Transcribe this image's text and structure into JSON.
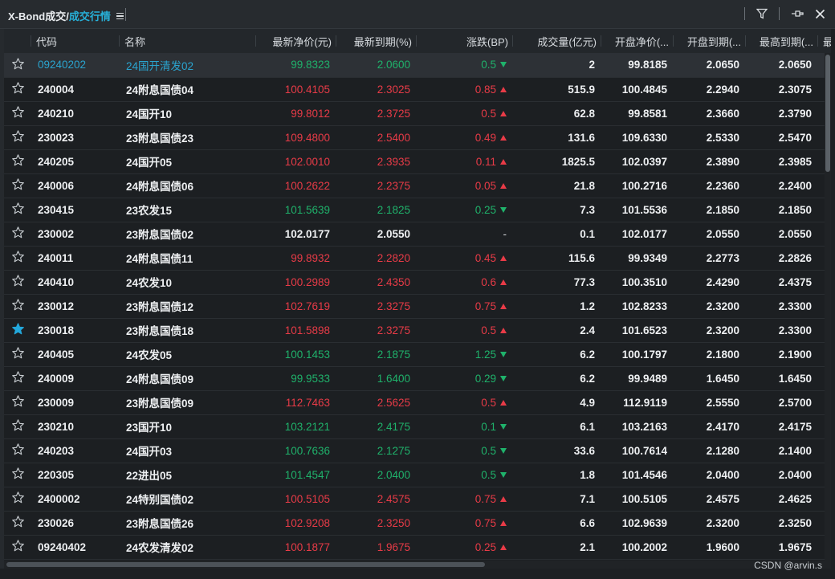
{
  "window": {
    "title_main": "X-Bond成交/",
    "title_sub": "成交行情",
    "watermark": "CSDN @arvin.s"
  },
  "icons": {
    "menu": "menu-icon",
    "filter": "filter-icon",
    "pin": "pin-icon",
    "close": "close-icon",
    "star": "star-icon"
  },
  "colors": {
    "up": "#e83b47",
    "down": "#1fb26b",
    "link": "#2aa4cf",
    "favorite": "#23a8dc"
  },
  "columns": [
    "代码",
    "名称",
    "最新净价(元)",
    "最新到期(%)",
    "涨跌(BP)",
    "成交量(亿元)",
    "开盘净价(...",
    "开盘到期(...",
    "最高到期(...",
    "最"
  ],
  "rows": [
    {
      "code": "09240202",
      "name": "24国开清发02",
      "price": "99.8323",
      "ytm": "2.0600",
      "change": "0.5",
      "dir": "down",
      "volume": "2",
      "open_price": "99.8185",
      "open_ytm": "2.0650",
      "high_ytm": "2.0650",
      "favorite": false
    },
    {
      "code": "240004",
      "name": "24附息国债04",
      "price": "100.4105",
      "ytm": "2.3025",
      "change": "0.85",
      "dir": "up",
      "volume": "515.9",
      "open_price": "100.4845",
      "open_ytm": "2.2940",
      "high_ytm": "2.3075",
      "favorite": false
    },
    {
      "code": "240210",
      "name": "24国开10",
      "price": "99.8012",
      "ytm": "2.3725",
      "change": "0.5",
      "dir": "up",
      "volume": "62.8",
      "open_price": "99.8581",
      "open_ytm": "2.3660",
      "high_ytm": "2.3790",
      "favorite": false
    },
    {
      "code": "230023",
      "name": "23附息国债23",
      "price": "109.4800",
      "ytm": "2.5400",
      "change": "0.49",
      "dir": "up",
      "volume": "131.6",
      "open_price": "109.6330",
      "open_ytm": "2.5330",
      "high_ytm": "2.5470",
      "favorite": false
    },
    {
      "code": "240205",
      "name": "24国开05",
      "price": "102.0010",
      "ytm": "2.3935",
      "change": "0.11",
      "dir": "up",
      "volume": "1825.5",
      "open_price": "102.0397",
      "open_ytm": "2.3890",
      "high_ytm": "2.3985",
      "favorite": false
    },
    {
      "code": "240006",
      "name": "24附息国债06",
      "price": "100.2622",
      "ytm": "2.2375",
      "change": "0.05",
      "dir": "up",
      "volume": "21.8",
      "open_price": "100.2716",
      "open_ytm": "2.2360",
      "high_ytm": "2.2400",
      "favorite": false
    },
    {
      "code": "230415",
      "name": "23农发15",
      "price": "101.5639",
      "ytm": "2.1825",
      "change": "0.25",
      "dir": "down",
      "volume": "7.3",
      "open_price": "101.5536",
      "open_ytm": "2.1850",
      "high_ytm": "2.1850",
      "favorite": false
    },
    {
      "code": "230002",
      "name": "23附息国债02",
      "price": "102.0177",
      "ytm": "2.0550",
      "change": "-",
      "dir": "flat",
      "volume": "0.1",
      "open_price": "102.0177",
      "open_ytm": "2.0550",
      "high_ytm": "2.0550",
      "favorite": false
    },
    {
      "code": "240011",
      "name": "24附息国债11",
      "price": "99.8932",
      "ytm": "2.2820",
      "change": "0.45",
      "dir": "up",
      "volume": "115.6",
      "open_price": "99.9349",
      "open_ytm": "2.2773",
      "high_ytm": "2.2826",
      "favorite": false
    },
    {
      "code": "240410",
      "name": "24农发10",
      "price": "100.2989",
      "ytm": "2.4350",
      "change": "0.6",
      "dir": "up",
      "volume": "77.3",
      "open_price": "100.3510",
      "open_ytm": "2.4290",
      "high_ytm": "2.4375",
      "favorite": false
    },
    {
      "code": "230012",
      "name": "23附息国债12",
      "price": "102.7619",
      "ytm": "2.3275",
      "change": "0.75",
      "dir": "up",
      "volume": "1.2",
      "open_price": "102.8233",
      "open_ytm": "2.3200",
      "high_ytm": "2.3300",
      "favorite": false
    },
    {
      "code": "230018",
      "name": "23附息国债18",
      "price": "101.5898",
      "ytm": "2.3275",
      "change": "0.5",
      "dir": "up",
      "volume": "2.4",
      "open_price": "101.6523",
      "open_ytm": "2.3200",
      "high_ytm": "2.3300",
      "favorite": true
    },
    {
      "code": "240405",
      "name": "24农发05",
      "price": "100.1453",
      "ytm": "2.1875",
      "change": "1.25",
      "dir": "down",
      "volume": "6.2",
      "open_price": "100.1797",
      "open_ytm": "2.1800",
      "high_ytm": "2.1900",
      "favorite": false
    },
    {
      "code": "240009",
      "name": "24附息国债09",
      "price": "99.9533",
      "ytm": "1.6400",
      "change": "0.29",
      "dir": "down",
      "volume": "6.2",
      "open_price": "99.9489",
      "open_ytm": "1.6450",
      "high_ytm": "1.6450",
      "favorite": false
    },
    {
      "code": "230009",
      "name": "23附息国债09",
      "price": "112.7463",
      "ytm": "2.5625",
      "change": "0.5",
      "dir": "up",
      "volume": "4.9",
      "open_price": "112.9119",
      "open_ytm": "2.5550",
      "high_ytm": "2.5700",
      "favorite": false
    },
    {
      "code": "230210",
      "name": "23国开10",
      "price": "103.2121",
      "ytm": "2.4175",
      "change": "0.1",
      "dir": "down",
      "volume": "6.1",
      "open_price": "103.2163",
      "open_ytm": "2.4170",
      "high_ytm": "2.4175",
      "favorite": false
    },
    {
      "code": "240203",
      "name": "24国开03",
      "price": "100.7636",
      "ytm": "2.1275",
      "change": "0.5",
      "dir": "down",
      "volume": "33.6",
      "open_price": "100.7614",
      "open_ytm": "2.1280",
      "high_ytm": "2.1400",
      "favorite": false
    },
    {
      "code": "220305",
      "name": "22进出05",
      "price": "101.4547",
      "ytm": "2.0400",
      "change": "0.5",
      "dir": "down",
      "volume": "1.8",
      "open_price": "101.4546",
      "open_ytm": "2.0400",
      "high_ytm": "2.0400",
      "favorite": false
    },
    {
      "code": "2400002",
      "name": "24特别国债02",
      "price": "100.5105",
      "ytm": "2.4575",
      "change": "0.75",
      "dir": "up",
      "volume": "7.1",
      "open_price": "100.5105",
      "open_ytm": "2.4575",
      "high_ytm": "2.4625",
      "favorite": false
    },
    {
      "code": "230026",
      "name": "23附息国债26",
      "price": "102.9208",
      "ytm": "2.3250",
      "change": "0.75",
      "dir": "up",
      "volume": "6.6",
      "open_price": "102.9639",
      "open_ytm": "2.3200",
      "high_ytm": "2.3250",
      "favorite": false
    },
    {
      "code": "09240402",
      "name": "24农发清发02",
      "price": "100.1877",
      "ytm": "1.9675",
      "change": "0.25",
      "dir": "up",
      "volume": "2.1",
      "open_price": "100.2002",
      "open_ytm": "1.9600",
      "high_ytm": "1.9675",
      "favorite": false
    }
  ]
}
